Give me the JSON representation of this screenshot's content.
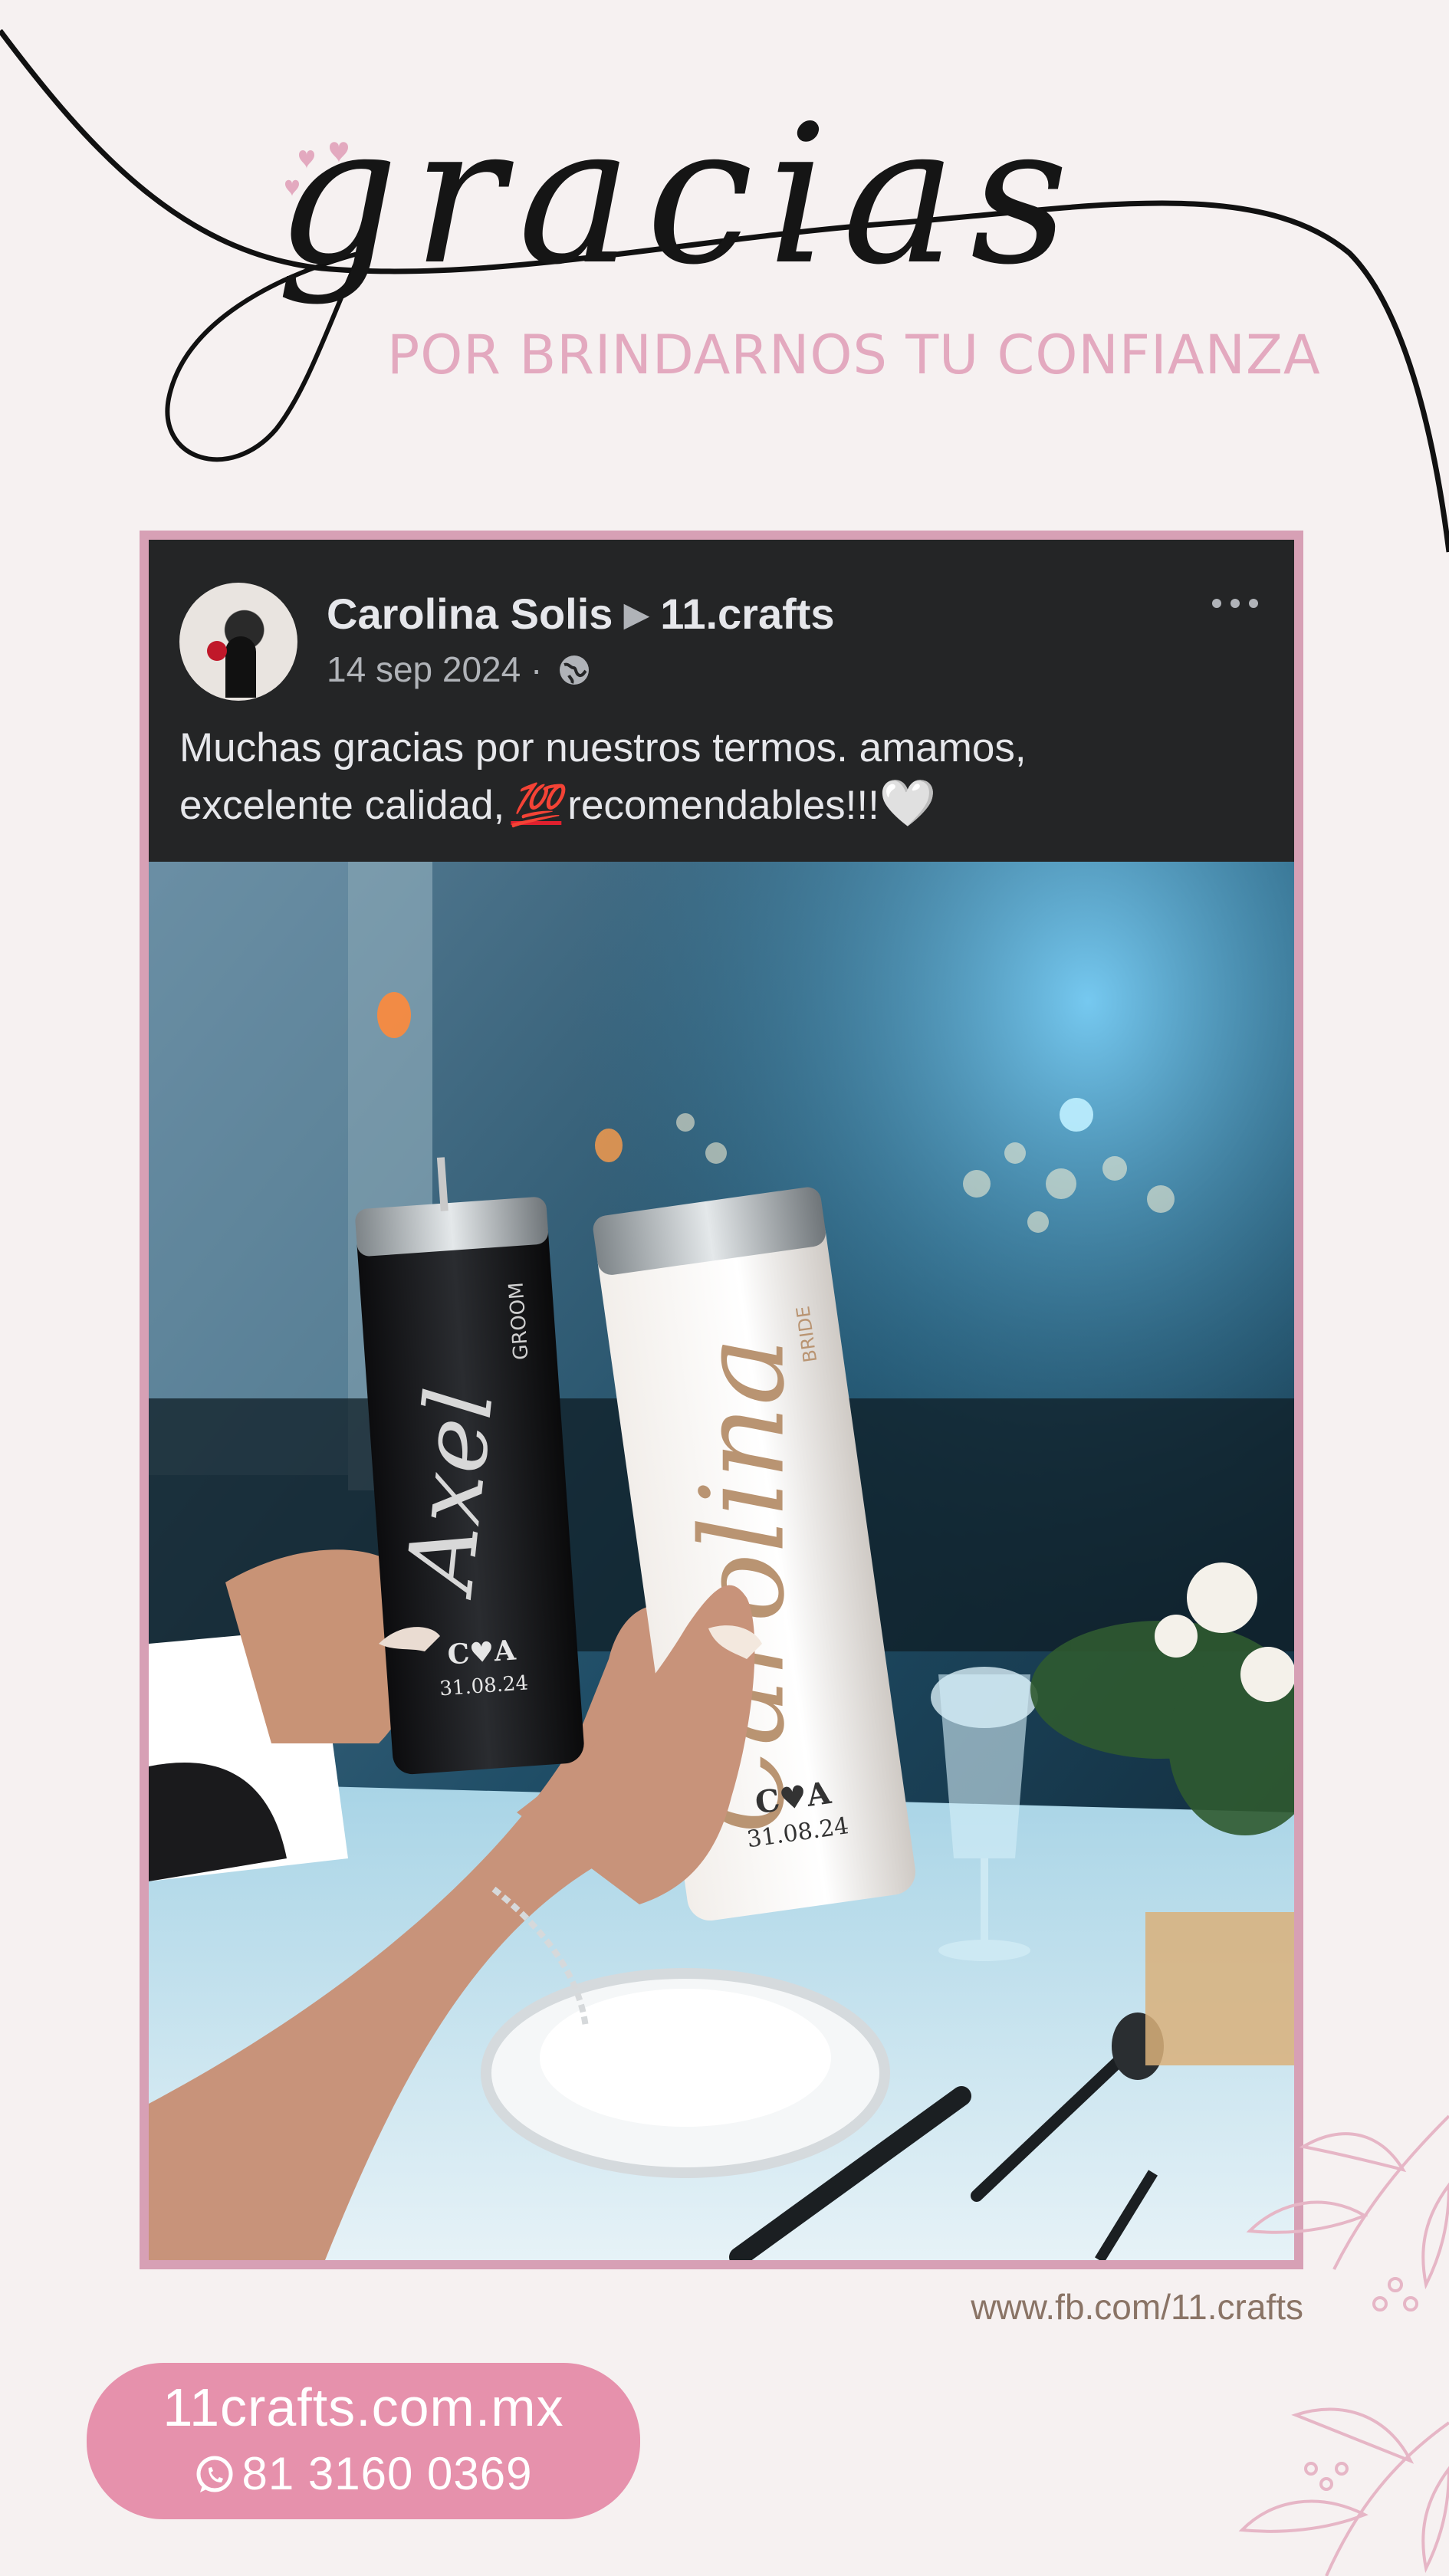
{
  "header": {
    "script_word": "gracias",
    "tagline": "POR BRINDARNOS TU CONFIANZA"
  },
  "post": {
    "author": "Carolina Solis",
    "target": "11.crafts",
    "date": "14 sep 2024 ·",
    "privacy_icon": "globe-icon",
    "menu_icon": "more-horizontal-icon",
    "caption_line1": "Muchas gracias por nuestros termos. amamos,",
    "caption_line2_start": "excelente calidad,",
    "caption_emoji": "💯",
    "caption_line2_end": "recomendables!!!",
    "caption_end_emoji": "🤍",
    "photo": {
      "tumbler_left_name": "Axel",
      "tumbler_left_role": "GROOM",
      "tumbler_right_name": "Carolina",
      "tumbler_right_role": "BRIDE",
      "monogram": "C♥A",
      "date": "31.08.24"
    }
  },
  "footer": {
    "website": "www.fb.com/11.crafts",
    "site": "11crafts.com.mx",
    "phone": "81 3160 0369",
    "phone_icon": "whatsapp-icon"
  },
  "colors": {
    "background": "#f6f1f1",
    "accent_pink": "#e691ac",
    "tagline_pink": "#e3a9bf",
    "frame_pink": "#d7a0b5",
    "post_dark": "#242526"
  }
}
